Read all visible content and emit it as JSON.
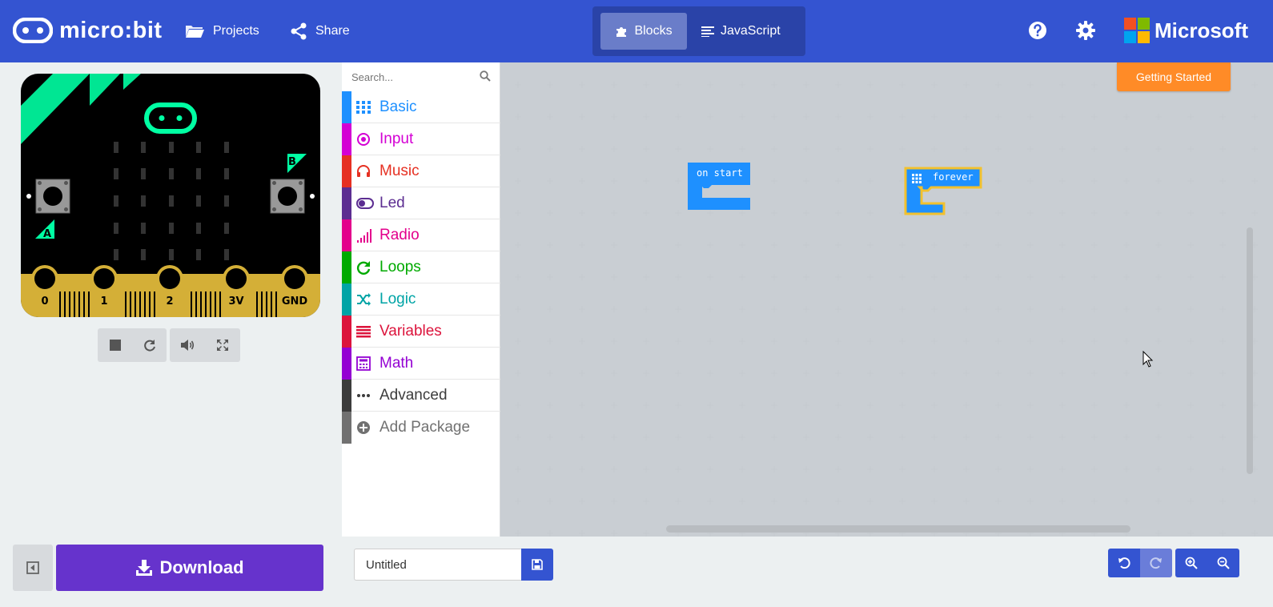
{
  "header": {
    "brand": "micro:bit",
    "projects_label": "Projects",
    "share_label": "Share",
    "blocks_label": "Blocks",
    "javascript_label": "JavaScript",
    "microsoft_label": "Microsoft",
    "icons": [
      "microbit-logo-icon",
      "folder-icon",
      "share-icon",
      "puzzle-icon",
      "code-lines-icon",
      "help-icon",
      "gear-icon",
      "microsoft-logo-icon"
    ],
    "color": "#3454d1"
  },
  "simulator": {
    "pin_labels": [
      "0",
      "1",
      "2",
      "3V",
      "GND"
    ],
    "button_labels": [
      "A",
      "B"
    ],
    "controls": [
      "stop-icon",
      "restart-icon",
      "mute-icon",
      "fullscreen-icon"
    ]
  },
  "toolbox": {
    "search_placeholder": "Search...",
    "categories": [
      {
        "label": "Basic",
        "color": "#1e90ff",
        "icon": "grid-icon"
      },
      {
        "label": "Input",
        "color": "#d400d4",
        "icon": "target-icon"
      },
      {
        "label": "Music",
        "color": "#e63022",
        "icon": "headphones-icon"
      },
      {
        "label": "Led",
        "color": "#5c2d91",
        "icon": "toggle-icon"
      },
      {
        "label": "Radio",
        "color": "#e3008c",
        "icon": "signal-icon"
      },
      {
        "label": "Loops",
        "color": "#00aa00",
        "icon": "refresh-icon"
      },
      {
        "label": "Logic",
        "color": "#00a4a6",
        "icon": "shuffle-icon"
      },
      {
        "label": "Variables",
        "color": "#dc143c",
        "icon": "list-icon"
      },
      {
        "label": "Math",
        "color": "#9400d3",
        "icon": "calculator-icon"
      },
      {
        "label": "Advanced",
        "color": "#3c3c3c",
        "icon": "ellipsis-icon"
      },
      {
        "label": "Add Package",
        "color": "#717171",
        "icon": "plus-circle-icon"
      }
    ]
  },
  "workspace": {
    "getting_started_label": "Getting Started",
    "blocks": [
      {
        "label": "on start"
      },
      {
        "label": "forever"
      }
    ]
  },
  "footer": {
    "download_label": "Download",
    "project_name": "Untitled",
    "icons": [
      "collapse-icon",
      "download-icon",
      "save-icon",
      "undo-icon",
      "redo-icon",
      "zoom-in-icon",
      "zoom-out-icon"
    ]
  }
}
